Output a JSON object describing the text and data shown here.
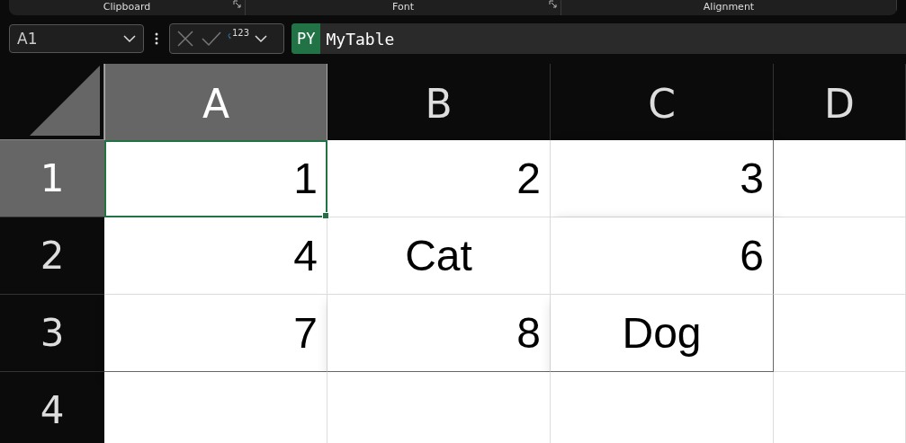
{
  "ribbon_groups": [
    "Clipboard",
    "Font",
    "Alignment"
  ],
  "name_box": {
    "value": "A1"
  },
  "formula_bar": {
    "badge": "PY",
    "value": "MyTable",
    "badge_icon": "123"
  },
  "columns": [
    {
      "label": "A",
      "selected": true
    },
    {
      "label": "B",
      "selected": false
    },
    {
      "label": "C",
      "selected": false
    },
    {
      "label": "D",
      "selected": false
    }
  ],
  "rows": [
    {
      "label": "1",
      "selected": true,
      "cells": [
        {
          "value": "1",
          "kind": "number",
          "selected": true
        },
        {
          "value": "2",
          "kind": "number",
          "selected": false
        },
        {
          "value": "3",
          "kind": "number",
          "selected": false
        }
      ]
    },
    {
      "label": "2",
      "selected": false,
      "cells": [
        {
          "value": "4",
          "kind": "number",
          "selected": false
        },
        {
          "value": "Cat",
          "kind": "text",
          "selected": false
        },
        {
          "value": "6",
          "kind": "number",
          "selected": false
        }
      ]
    },
    {
      "label": "3",
      "selected": false,
      "cells": [
        {
          "value": "7",
          "kind": "number",
          "selected": false
        },
        {
          "value": "8",
          "kind": "number",
          "selected": false
        },
        {
          "value": "Dog",
          "kind": "text",
          "selected": false
        }
      ]
    },
    {
      "label": "4",
      "selected": false,
      "cells": []
    }
  ]
}
